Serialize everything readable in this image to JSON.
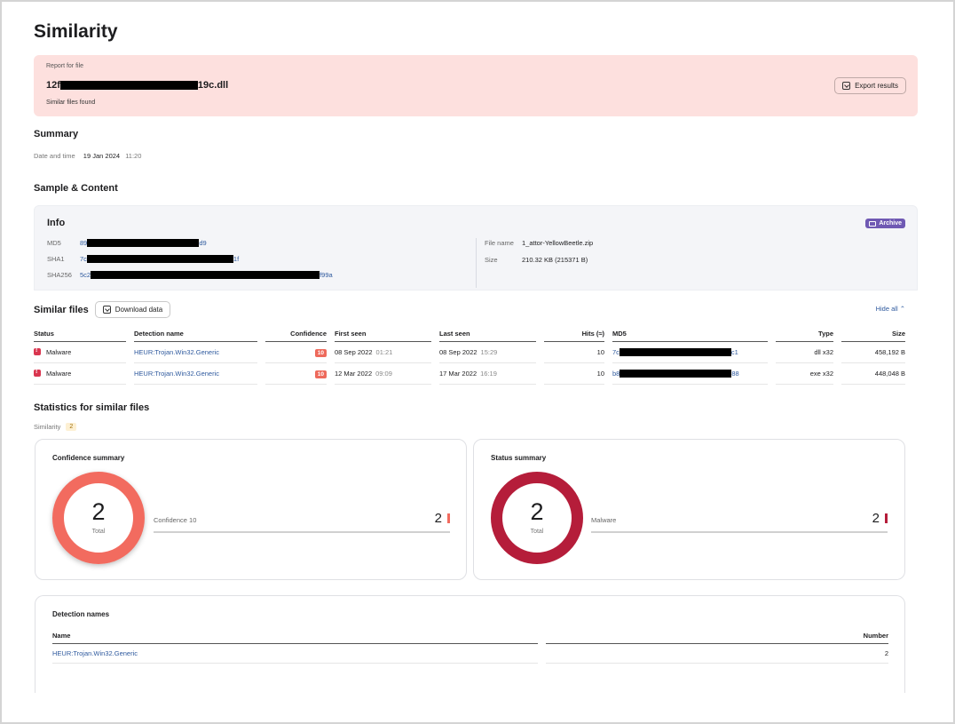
{
  "page": {
    "title": "Similarity"
  },
  "banner": {
    "label": "Report for file",
    "file_prefix": "12f",
    "file_suffix": "19c.dll",
    "subtitle": "Similar files found",
    "export_label": "Export results"
  },
  "summary": {
    "heading": "Summary",
    "date_label": "Date and time",
    "date": "19 Jan 2024",
    "time": "11:20"
  },
  "sample": {
    "heading": "Sample & Content"
  },
  "info": {
    "title": "Info",
    "badge": "Archive",
    "md5_label": "MD5",
    "md5_prefix": "89",
    "md5_suffix": "d9",
    "sha1_label": "SHA1",
    "sha1_prefix": "7c",
    "sha1_suffix": "1f",
    "sha256_label": "SHA256",
    "sha256_prefix": "5c2",
    "sha256_suffix": "f99a",
    "filename_label": "File name",
    "filename": "1_attor-YellowBeetle.zip",
    "size_label": "Size",
    "size": "210.32 KB (215371 B)"
  },
  "similar": {
    "heading": "Similar files",
    "download_label": "Download data",
    "hide_all": "Hide all",
    "columns": [
      "Status",
      "Detection name",
      "Confidence",
      "First seen",
      "Last seen",
      "Hits (≈)",
      "MD5",
      "Type",
      "Size"
    ],
    "rows": [
      {
        "status": "Malware",
        "detection": "HEUR:Trojan.Win32.Generic",
        "confidence": "10",
        "first_date": "08 Sep 2022",
        "first_time": "01:21",
        "last_date": "08 Sep 2022",
        "last_time": "15:29",
        "hits": "10",
        "md5_prefix": "7c",
        "md5_suffix": "c1",
        "type": "dll x32",
        "size": "458,192 B"
      },
      {
        "status": "Malware",
        "detection": "HEUR:Trojan.Win32.Generic",
        "confidence": "10",
        "first_date": "12 Mar 2022",
        "first_time": "09:09",
        "last_date": "17 Mar 2022",
        "last_time": "16:19",
        "hits": "10",
        "md5_prefix": "b8",
        "md5_suffix": "88",
        "type": "exe x32",
        "size": "448,048 B"
      }
    ]
  },
  "stats": {
    "heading": "Statistics for similar files",
    "similarity_label": "Similarity",
    "similarity_count": "2",
    "confidence": {
      "title": "Confidence summary",
      "total": "2",
      "total_label": "Total",
      "item_label": "Confidence 10",
      "item_value": "2",
      "color": "#f26b5f"
    },
    "status": {
      "title": "Status summary",
      "total": "2",
      "total_label": "Total",
      "item_label": "Malware",
      "item_value": "2",
      "color": "#b51d3a"
    }
  },
  "detection_names": {
    "title": "Detection names",
    "col_name": "Name",
    "col_number": "Number",
    "rows": [
      {
        "name": "HEUR:Trojan.Win32.Generic",
        "number": "2"
      }
    ]
  }
}
